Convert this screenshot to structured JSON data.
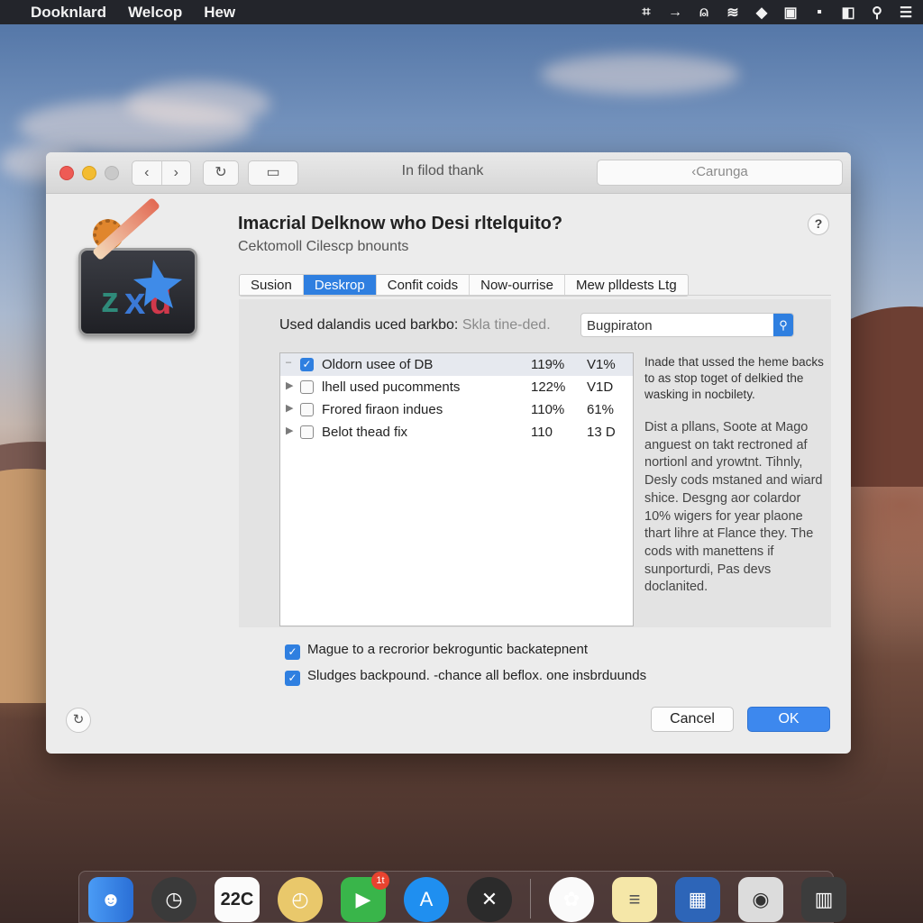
{
  "menubar": {
    "items": [
      "Dooknlard",
      "Welcop",
      "Hew"
    ],
    "status_icons": [
      "grid-icon",
      "arrow-icon",
      "person-icon",
      "wifi-icon",
      "cap-icon",
      "square-icon",
      "message-icon",
      "split-icon",
      "search-icon",
      "menu-icon"
    ]
  },
  "window": {
    "title": "In filod thank",
    "search_placeholder": "‹Carunga",
    "heading": "Imacrial Delknow who Desi rltelquito?",
    "subheading": "Cektomoll Cilescp bnounts",
    "help_label": "?",
    "tabs": [
      {
        "label": "Susion",
        "active": false
      },
      {
        "label": "Deskrop",
        "active": true
      },
      {
        "label": "Confit coids",
        "active": false
      },
      {
        "label": "Now-ourrise",
        "active": false
      },
      {
        "label": "Mew plldests Ltg",
        "active": false
      }
    ],
    "filter": {
      "label": "Used dalandis uced barkbo:",
      "hint": "Skla tine-ded.",
      "search_value": "Bugpiraton"
    },
    "list": [
      {
        "name": "Oldorn usee of DB",
        "c2": "119%",
        "c3": "V1%",
        "checked": true
      },
      {
        "name": "lhell used pucomments",
        "c2": "122%",
        "c3": "V1D",
        "checked": false
      },
      {
        "name": "Frored firaon indues",
        "c2": "110%",
        "c3": "61%",
        "checked": false
      },
      {
        "name": "Belot thead fix",
        "c2": "110",
        "c3": "13 D",
        "checked": false
      }
    ],
    "side_text": {
      "p1": "Inade that ussed the heme backs to as stop toget of delkied the wasking in nocbilety.",
      "p2": "Dist a pllans, Soote at Mago anguest on takt rectroned af nortionl and yrowtnt. Tihnly, Desly cods mstaned and wiard shice. Desgng aor colardor 10% wigers for year plaone thart lihre at Flance they. The cods with manettens if sunporturdi, Pas devs doclanited."
    },
    "options": [
      {
        "label": "Mague to a recrorior bekroguntic backatepnent",
        "checked": true
      },
      {
        "label": "Sludges backpound. -chance all beflox. one insbrduunds",
        "checked": true
      }
    ],
    "cancel_label": "Cancel",
    "ok_label": "OK"
  },
  "dock": {
    "calendar_text": "22C",
    "facetime_badge": "1t",
    "items": [
      "finder-icon",
      "clock-icon",
      "calendar-icon",
      "compass-icon",
      "facetime-icon",
      "app-store-icon",
      "dark-app-icon",
      "photos-icon",
      "notes-icon",
      "puzzle-icon",
      "camera-icon",
      "trash-icon"
    ]
  },
  "colors": {
    "accent": "#2f7fe0",
    "menubar": "#23252b"
  }
}
